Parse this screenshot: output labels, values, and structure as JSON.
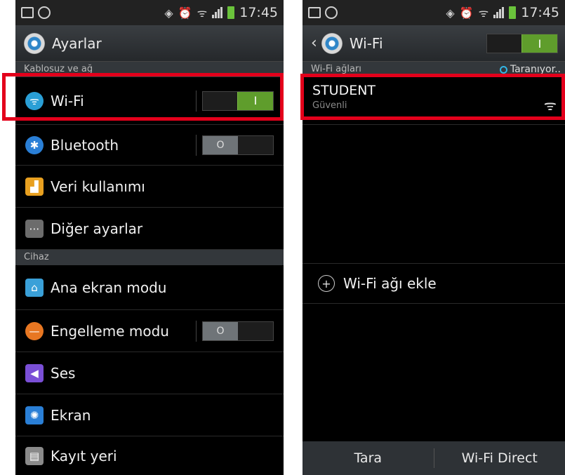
{
  "status": {
    "time": "17:45"
  },
  "left": {
    "title": "Ayarlar",
    "sections": {
      "wireless": "Kablosuz ve ağ",
      "device": "Cihaz"
    },
    "items": [
      {
        "label": "Wi-Fi",
        "icon": "wifi-icon",
        "toggle": "on"
      },
      {
        "label": "Bluetooth",
        "icon": "bluetooth-icon",
        "toggle": "off"
      },
      {
        "label": "Veri kullanımı",
        "icon": "data-usage-icon"
      },
      {
        "label": "Diğer ayarlar",
        "icon": "more-icon"
      },
      {
        "label": "Ana ekran modu",
        "icon": "home-icon"
      },
      {
        "label": "Engelleme modu",
        "icon": "block-icon",
        "toggle": "off"
      },
      {
        "label": "Ses",
        "icon": "sound-icon"
      },
      {
        "label": "Ekran",
        "icon": "display-icon"
      },
      {
        "label": "Kayıt yeri",
        "icon": "storage-icon"
      }
    ],
    "toggle_on_glyph": "I",
    "toggle_off_glyph": "O"
  },
  "right": {
    "title": "Wi-Fi",
    "networks_header": "Wi-Fi ağları",
    "scanning_text": "Taranıyor..",
    "network": {
      "ssid": "STUDENT",
      "security": "Güvenli"
    },
    "add_network": "Wi-Fi ağı ekle",
    "add_glyph": "+",
    "buttons": {
      "scan": "Tara",
      "direct": "Wi-Fi Direct"
    }
  },
  "colors": {
    "highlight": "#e3001b",
    "toggle_on": "#5f9d2c",
    "accent": "#33b5e5"
  }
}
